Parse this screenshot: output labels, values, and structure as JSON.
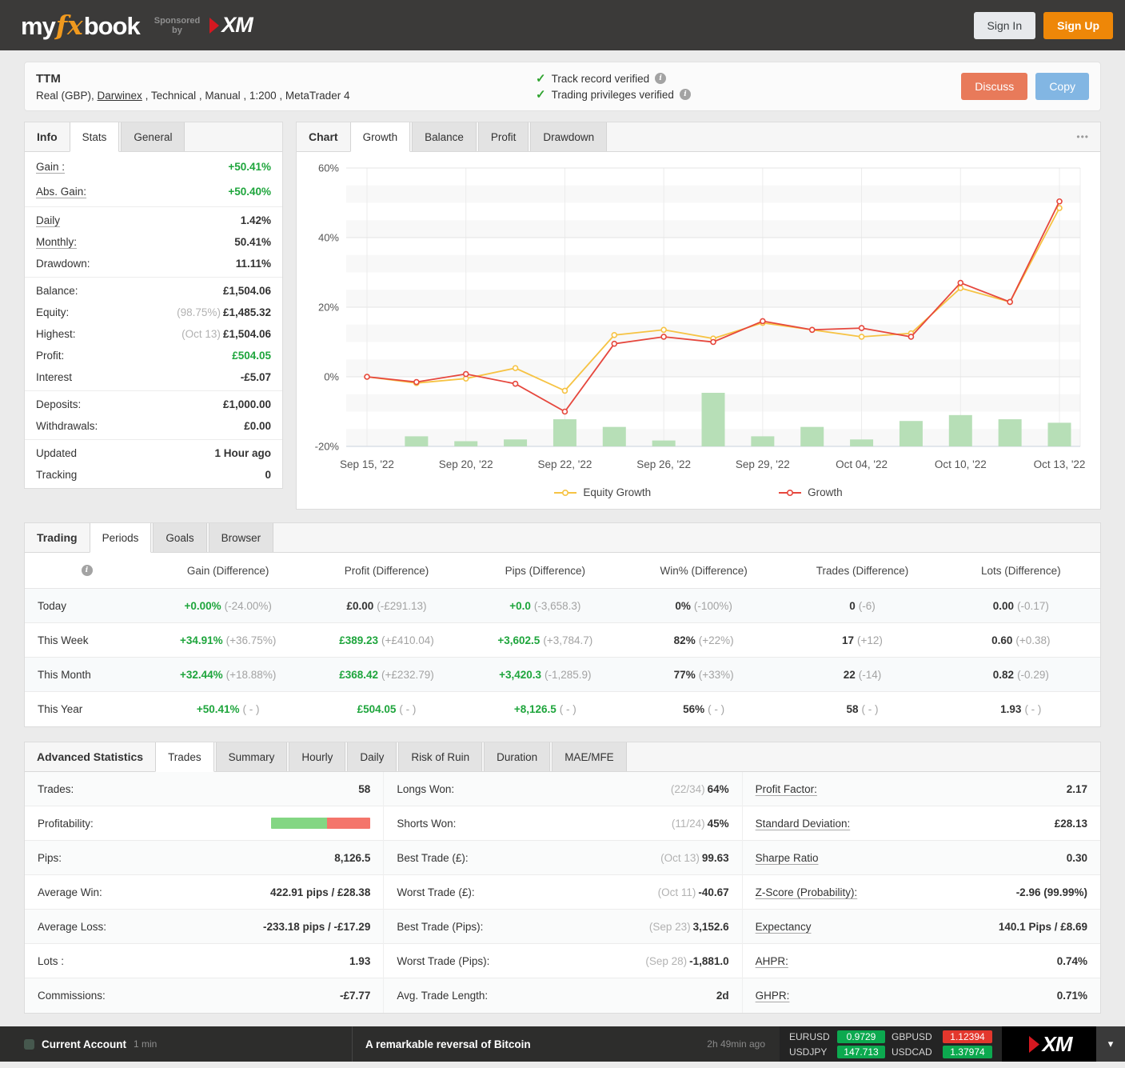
{
  "colors": {
    "accent_orange": "#ee8708",
    "discuss_coral": "#e87a5a",
    "copy_blue": "#82b6e3",
    "positive_green": "#1ea53c",
    "ticker_up_green": "#0ca94f",
    "ticker_down_red": "#e3372d",
    "equity_line": "#f6c344",
    "growth_line": "#e6473d",
    "volume_bar": "#b7dfb7"
  },
  "header": {
    "logo_my": "my",
    "logo_fx": "fx",
    "logo_book": "book",
    "sponsored_line1": "Sponsored",
    "sponsored_line2": "by",
    "xm_text": "XM",
    "sign_in": "Sign In",
    "sign_up": "Sign Up"
  },
  "account": {
    "name": "TTM",
    "subtitle_prefix": "Real (GBP), ",
    "subtitle_link": "Darwinex",
    "subtitle_suffix": " , Technical , Manual , 1:200 , MetaTrader 4",
    "check_icon": "✓",
    "info_icon": "i",
    "verified1": "Track record verified",
    "verified2": "Trading privileges verified",
    "discuss": "Discuss",
    "copy": "Copy"
  },
  "stats_panel": {
    "title_tab": "Info",
    "active_tab": "Stats",
    "tab_general": "General",
    "gain_label": "Gain :",
    "gain_value": "+50.41%",
    "abs_gain_label": "Abs. Gain:",
    "abs_gain_value": "+50.40%",
    "daily_label": "Daily",
    "daily_value": "1.42%",
    "monthly_label": "Monthly:",
    "monthly_value": "50.41%",
    "drawdown_label": "Drawdown:",
    "drawdown_value": "11.11%",
    "balance_label": "Balance:",
    "balance_value": "£1,504.06",
    "equity_label": "Equity:",
    "equity_pre": "(98.75%)",
    "equity_value": "£1,485.32",
    "highest_label": "Highest:",
    "highest_pre": "(Oct 13)",
    "highest_value": "£1,504.06",
    "profit_label": "Profit:",
    "profit_value": "£504.05",
    "interest_label": "Interest",
    "interest_value": "-£5.07",
    "deposits_label": "Deposits:",
    "deposits_value": "£1,000.00",
    "withdrawals_label": "Withdrawals:",
    "withdrawals_value": "£0.00",
    "updated_label": "Updated",
    "updated_value": "1 Hour ago",
    "tracking_label": "Tracking",
    "tracking_value": "0"
  },
  "chart_panel": {
    "title_tab": "Chart",
    "tab_growth": "Growth",
    "tab_balance": "Balance",
    "tab_profit": "Profit",
    "tab_drawdown": "Drawdown",
    "menu_icon": "•••",
    "legend1": "Equity Growth",
    "legend2": "Growth"
  },
  "chart_data": {
    "type": "line",
    "title": "",
    "xlabel": "",
    "ylabel": "",
    "n_points": 15,
    "x_labels": [
      "Sep 15, '22",
      "Sep 20, '22",
      "Sep 22, '22",
      "Sep 26, '22",
      "Sep 29, '22",
      "Oct 04, '22",
      "Oct 10, '22",
      "Oct 13, '22"
    ],
    "label_indices": [
      0,
      2,
      4,
      6,
      8,
      10,
      12,
      14
    ],
    "ylim": [
      -20,
      60
    ],
    "yticks": [
      -20,
      0,
      20,
      40,
      60
    ],
    "grid": true,
    "legend_position": "bottom",
    "series": [
      {
        "name": "Equity Growth",
        "color": "#f6c344",
        "values": [
          0.0,
          -1.8,
          -0.5,
          2.5,
          -4.0,
          12.0,
          13.5,
          11.0,
          15.5,
          13.5,
          11.5,
          12.5,
          25.5,
          21.5,
          48.5
        ]
      },
      {
        "name": "Growth",
        "color": "#e6473d",
        "values": [
          0.0,
          -1.5,
          0.8,
          -2.0,
          -10.0,
          9.5,
          11.5,
          10.0,
          16.0,
          13.5,
          14.0,
          11.5,
          27.0,
          21.5,
          50.4
        ]
      }
    ],
    "bars": {
      "name": "volume",
      "color": "#b7dfb7",
      "baseline": -20,
      "heights": [
        null,
        2.9,
        1.5,
        2.0,
        7.8,
        5.6,
        1.7,
        15.4,
        2.9,
        5.6,
        2.0,
        7.3,
        9.0,
        7.8,
        6.8
      ]
    }
  },
  "periods_panel": {
    "title_tab": "Trading",
    "active_tab": "Periods",
    "tab_goals": "Goals",
    "tab_browser": "Browser",
    "info_icon": "i",
    "columns": [
      "Gain (Difference)",
      "Profit (Difference)",
      "Pips (Difference)",
      "Win% (Difference)",
      "Trades (Difference)",
      "Lots (Difference)"
    ],
    "rows": [
      {
        "label": "Today",
        "cells": [
          {
            "main": "+0.00%",
            "diff": "(-24.00%)",
            "cls": "green"
          },
          {
            "main": "£0.00",
            "diff": "(-£291.13)",
            "cls": ""
          },
          {
            "main": "+0.0",
            "diff": "(-3,658.3)",
            "cls": "green"
          },
          {
            "main": "0%",
            "diff": "(-100%)",
            "cls": ""
          },
          {
            "main": "0",
            "diff": "(-6)",
            "cls": ""
          },
          {
            "main": "0.00",
            "diff": "(-0.17)",
            "cls": ""
          }
        ]
      },
      {
        "label": "This Week",
        "cells": [
          {
            "main": "+34.91%",
            "diff": "(+36.75%)",
            "cls": "green"
          },
          {
            "main": "£389.23",
            "diff": "(+£410.04)",
            "cls": "green"
          },
          {
            "main": "+3,602.5",
            "diff": "(+3,784.7)",
            "cls": "green"
          },
          {
            "main": "82%",
            "diff": "(+22%)",
            "cls": ""
          },
          {
            "main": "17",
            "diff": "(+12)",
            "cls": ""
          },
          {
            "main": "0.60",
            "diff": "(+0.38)",
            "cls": ""
          }
        ]
      },
      {
        "label": "This Month",
        "cells": [
          {
            "main": "+32.44%",
            "diff": "(+18.88%)",
            "cls": "green"
          },
          {
            "main": "£368.42",
            "diff": "(+£232.79)",
            "cls": "green"
          },
          {
            "main": "+3,420.3",
            "diff": "(-1,285.9)",
            "cls": "green"
          },
          {
            "main": "77%",
            "diff": "(+33%)",
            "cls": ""
          },
          {
            "main": "22",
            "diff": "(-14)",
            "cls": ""
          },
          {
            "main": "0.82",
            "diff": "(-0.29)",
            "cls": ""
          }
        ]
      },
      {
        "label": "This Year",
        "cells": [
          {
            "main": "+50.41%",
            "diff": "( - )",
            "cls": "green"
          },
          {
            "main": "£504.05",
            "diff": "( - )",
            "cls": "green"
          },
          {
            "main": "+8,126.5",
            "diff": "( - )",
            "cls": "green"
          },
          {
            "main": "56%",
            "diff": "( - )",
            "cls": ""
          },
          {
            "main": "58",
            "diff": "( - )",
            "cls": ""
          },
          {
            "main": "1.93",
            "diff": "( - )",
            "cls": ""
          }
        ]
      }
    ]
  },
  "advanced_panel": {
    "title": "Advanced Statistics",
    "active_tab": "Trades",
    "tab_summary": "Summary",
    "tab_hourly": "Hourly",
    "tab_daily": "Daily",
    "tab_risk": "Risk of Ruin",
    "tab_duration": "Duration",
    "tab_maemfe": "MAE/MFE",
    "col1": {
      "trades_label": "Trades:",
      "trades_value": "58",
      "profitability_label": "Profitability:",
      "profitability_green_pct": 56,
      "profitability_red_pct": 44,
      "pips_label": "Pips:",
      "pips_value": "8,126.5",
      "avg_win_label": "Average Win:",
      "avg_win_value": "422.91 pips / £28.38",
      "avg_loss_label": "Average Loss:",
      "avg_loss_value": "-233.18 pips / -£17.29",
      "lots_label": "Lots :",
      "lots_value": "1.93",
      "commissions_label": "Commissions:",
      "commissions_value": "-£7.77"
    },
    "col2": {
      "longs_label": "Longs Won:",
      "longs_pre": "(22/34)",
      "longs_value": "64%",
      "shorts_label": "Shorts Won:",
      "shorts_pre": "(11/24)",
      "shorts_value": "45%",
      "best_trade_label": "Best Trade (£):",
      "best_trade_pre": "(Oct 13)",
      "best_trade_value": "99.63",
      "worst_trade_label": "Worst Trade (£):",
      "worst_trade_pre": "(Oct 11)",
      "worst_trade_value": "-40.67",
      "best_pips_label": "Best Trade (Pips):",
      "best_pips_pre": "(Sep 23)",
      "best_pips_value": "3,152.6",
      "worst_pips_label": "Worst Trade (Pips):",
      "worst_pips_pre": "(Sep 28)",
      "worst_pips_value": "-1,881.0",
      "trade_length_label": "Avg. Trade Length:",
      "trade_length_value": "2d"
    },
    "col3": {
      "profit_factor_label": "Profit Factor:",
      "profit_factor_value": "2.17",
      "std_dev_label": "Standard Deviation:",
      "std_dev_value": "£28.13",
      "sharpe_label": "Sharpe Ratio",
      "sharpe_value": "0.30",
      "zscore_label": "Z-Score (Probability):",
      "zscore_value": "-2.96 (99.99%)",
      "expectancy_label": "Expectancy",
      "expectancy_value": "140.1 Pips / £8.69",
      "ahpr_label": "AHPR:",
      "ahpr_value": "0.74%",
      "ghpr_label": "GHPR:",
      "ghpr_value": "0.71%"
    }
  },
  "footer": {
    "account_label": "Current Account",
    "account_time": "1 min",
    "news_title": "A remarkable reversal of Bitcoin",
    "news_time": "2h 49min ago",
    "quotes": [
      {
        "symbol": "EURUSD",
        "price": "0.9729",
        "dir": "up"
      },
      {
        "symbol": "GBPUSD",
        "price": "1.12394",
        "dir": "down"
      },
      {
        "symbol": "USDJPY",
        "price": "147.713",
        "dir": "up"
      },
      {
        "symbol": "USDCAD",
        "price": "1.37974",
        "dir": "up"
      }
    ],
    "xm_text": "XM",
    "chevron_icon": "▾"
  }
}
